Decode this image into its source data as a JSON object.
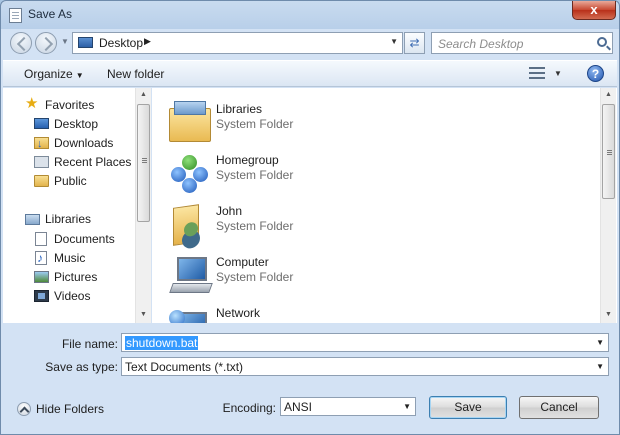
{
  "window": {
    "title": "Save As",
    "close_label": "x"
  },
  "address": {
    "location": "Desktop",
    "crumb_arrow": "▶",
    "drop": "▼"
  },
  "search": {
    "placeholder": "Search Desktop"
  },
  "toolbar": {
    "organize_label": "Organize",
    "organize_arrow": "▼",
    "new_folder_label": "New folder",
    "views_arrow": "▼",
    "help_label": "?"
  },
  "nav": {
    "favorites": [
      {
        "label": "Favorites",
        "icon": "star-icon"
      },
      {
        "label": "Desktop",
        "icon": "desktop-icon"
      },
      {
        "label": "Downloads",
        "icon": "downloads-icon"
      },
      {
        "label": "Recent Places",
        "icon": "recent-places-icon"
      },
      {
        "label": "Public",
        "icon": "folder-icon"
      }
    ],
    "libraries": [
      {
        "label": "Libraries",
        "icon": "libraries-icon"
      },
      {
        "label": "Documents",
        "icon": "documents-icon"
      },
      {
        "label": "Music",
        "icon": "music-icon"
      },
      {
        "label": "Pictures",
        "icon": "pictures-icon"
      },
      {
        "label": "Videos",
        "icon": "videos-icon"
      }
    ]
  },
  "files": [
    {
      "name": "Libraries",
      "type": "System Folder",
      "icon": "libraries-folder-icon"
    },
    {
      "name": "Homegroup",
      "type": "System Folder",
      "icon": "homegroup-icon"
    },
    {
      "name": "John",
      "type": "System Folder",
      "icon": "user-folder-icon"
    },
    {
      "name": "Computer",
      "type": "System Folder",
      "icon": "computer-icon"
    },
    {
      "name": "Network",
      "type": "",
      "icon": "network-icon"
    }
  ],
  "form": {
    "file_name_label": "File name:",
    "file_name_value": "shutdown.bat",
    "save_type_label": "Save as type:",
    "save_type_value": "Text Documents (*.txt)",
    "encoding_label": "Encoding:",
    "encoding_value": "ANSI",
    "drop": "▼"
  },
  "footer": {
    "hide_folders_label": "Hide Folders",
    "save_label": "Save",
    "cancel_label": "Cancel"
  },
  "colors": {
    "selection": "#3399ff",
    "frame": "#c9dbef",
    "pane": "#ffffff"
  }
}
